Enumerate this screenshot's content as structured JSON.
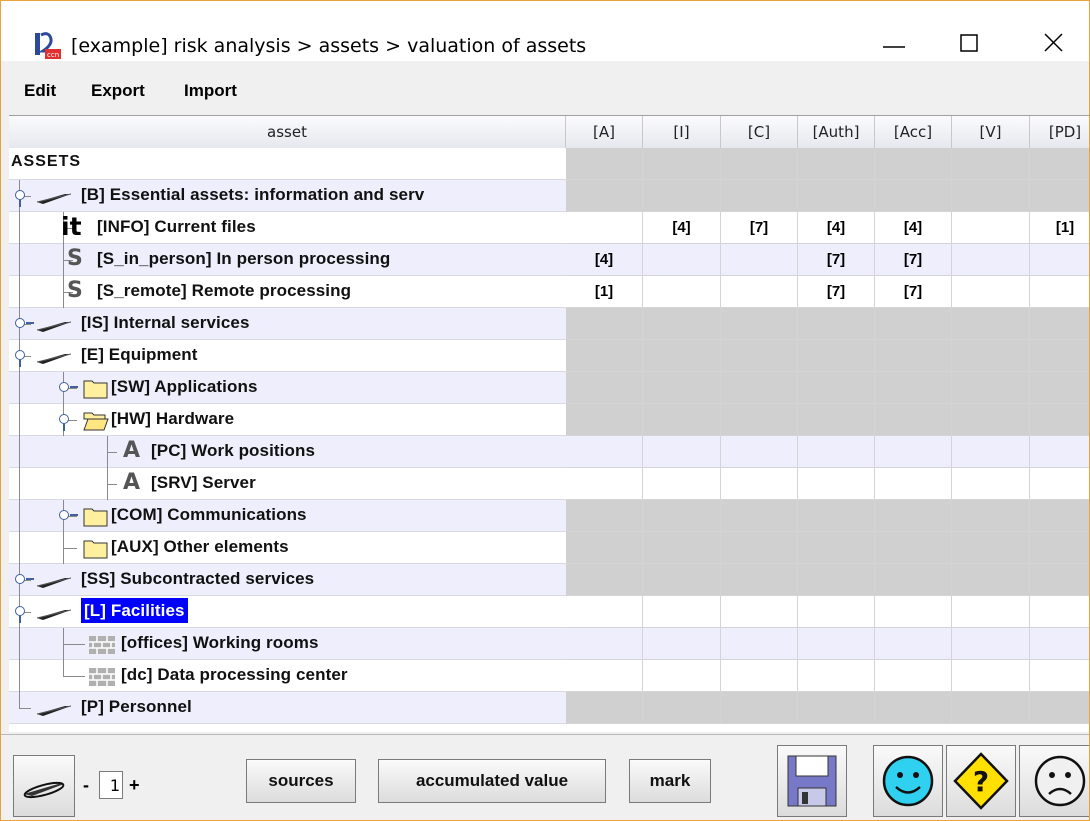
{
  "window": {
    "title": "[example] risk analysis > assets > valuation of assets",
    "minimize_glyph": "—",
    "maximize_glyph": "☐",
    "close_glyph": "✕"
  },
  "menu": {
    "items": [
      "Edit",
      "Export",
      "Import"
    ]
  },
  "table": {
    "columns": [
      "asset",
      "[A]",
      "[I]",
      "[C]",
      "[Auth]",
      "[Acc]",
      "[V]",
      "[PD]"
    ],
    "rows": [
      {
        "label": "ASSETS",
        "icon": "none",
        "values": [
          "",
          "",
          "",
          "",
          "",
          "",
          ""
        ]
      },
      {
        "label": "[B] Essential assets: information and serv",
        "icon": "dish-icon",
        "values": [
          "",
          "",
          "",
          "",
          "",
          "",
          ""
        ]
      },
      {
        "label": "[INFO] Current files",
        "icon": "info-it-icon",
        "icon_text": "it",
        "values": [
          "",
          "[4]",
          "[7]",
          "[4]",
          "[4]",
          "",
          "[1]"
        ]
      },
      {
        "label": "[S_in_person] In person processing",
        "icon": "service-s-icon",
        "icon_text": "S",
        "values": [
          "[4]",
          "",
          "",
          "[7]",
          "[7]",
          "",
          ""
        ]
      },
      {
        "label": "[S_remote] Remote processing",
        "icon": "service-s-icon",
        "icon_text": "S",
        "values": [
          "[1]",
          "",
          "",
          "[7]",
          "[7]",
          "",
          ""
        ]
      },
      {
        "label": "[IS] Internal services",
        "icon": "dish-icon",
        "values": [
          "",
          "",
          "",
          "",
          "",
          "",
          ""
        ]
      },
      {
        "label": "[E] Equipment",
        "icon": "dish-icon",
        "values": [
          "",
          "",
          "",
          "",
          "",
          "",
          ""
        ]
      },
      {
        "label": "[SW] Applications",
        "icon": "folder-icon",
        "values": [
          "",
          "",
          "",
          "",
          "",
          "",
          ""
        ]
      },
      {
        "label": "[HW] Hardware",
        "icon": "folder-open-icon",
        "values": [
          "",
          "",
          "",
          "",
          "",
          "",
          ""
        ]
      },
      {
        "label": "[PC] Work positions",
        "icon": "asset-a-icon",
        "icon_text": "A",
        "values": [
          "",
          "",
          "",
          "",
          "",
          "",
          ""
        ]
      },
      {
        "label": "[SRV] Server",
        "icon": "asset-a-icon",
        "icon_text": "A",
        "values": [
          "",
          "",
          "",
          "",
          "",
          "",
          ""
        ]
      },
      {
        "label": "[COM] Communications",
        "icon": "folder-icon",
        "values": [
          "",
          "",
          "",
          "",
          "",
          "",
          ""
        ]
      },
      {
        "label": "[AUX] Other elements",
        "icon": "folder-icon",
        "values": [
          "",
          "",
          "",
          "",
          "",
          "",
          ""
        ]
      },
      {
        "label": "[SS] Subcontracted services",
        "icon": "dish-icon",
        "values": [
          "",
          "",
          "",
          "",
          "",
          "",
          ""
        ]
      },
      {
        "label": "[L] Facilities",
        "icon": "dish-icon",
        "values": [
          "",
          "",
          "",
          "",
          "",
          "",
          ""
        ],
        "selected": true
      },
      {
        "label": "[offices] Working rooms",
        "icon": "wall-icon",
        "values": [
          "",
          "",
          "",
          "",
          "",
          "",
          ""
        ]
      },
      {
        "label": "[dc] Data processing center",
        "icon": "wall-icon",
        "values": [
          "",
          "",
          "",
          "",
          "",
          "",
          ""
        ]
      },
      {
        "label": "[P] Personnel",
        "icon": "dish-icon",
        "values": [
          "",
          "",
          "",
          "",
          "",
          "",
          ""
        ]
      }
    ]
  },
  "toolbar": {
    "level_minus": "-",
    "level_value": "1",
    "level_plus": "+",
    "sources_label": "sources",
    "accumulated_label": "accumulated value",
    "mark_label": "mark"
  },
  "colors": {
    "selection": "#0000ff",
    "grey_cell": "#d0d0d0",
    "stripe": "#eeeefc",
    "smile": "#2fd0f0",
    "help": "#ffe000"
  }
}
